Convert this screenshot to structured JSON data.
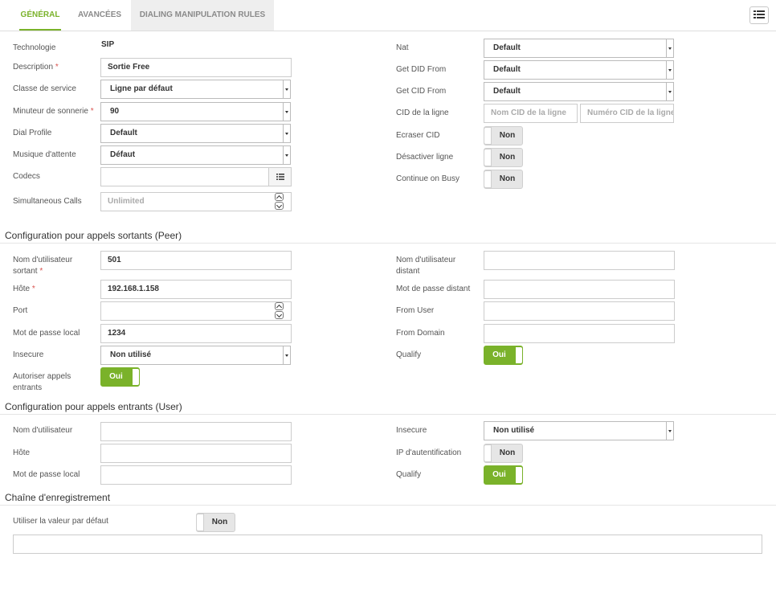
{
  "tabs": [
    {
      "label": "GÉNÉRAL",
      "active": true
    },
    {
      "label": "AVANCÉES",
      "active": false
    },
    {
      "label": "DIALING MANIPULATION RULES",
      "active": false
    }
  ],
  "toolbar": {
    "list_icon": "list-icon"
  },
  "general": {
    "technology": {
      "label": "Technologie",
      "value": "SIP"
    },
    "description": {
      "label": "Description",
      "value": "Sortie Free"
    },
    "service_class": {
      "label": "Classe de service",
      "value": "Ligne par défaut"
    },
    "ring_timer": {
      "label": "Minuteur de sonnerie",
      "value": "90"
    },
    "dial_profile": {
      "label": "Dial Profile",
      "value": "Default"
    },
    "music_on_hold": {
      "label": "Musique d'attente",
      "value": "Défaut"
    },
    "codecs": {
      "label": "Codecs",
      "value": ""
    },
    "simultaneous_calls": {
      "label": "Simultaneous Calls",
      "placeholder": "Unlimited"
    },
    "nat": {
      "label": "Nat",
      "value": "Default"
    },
    "get_did_from": {
      "label": "Get DID From",
      "value": "Default"
    },
    "get_cid_from": {
      "label": "Get CID From",
      "value": "Default"
    },
    "line_cid": {
      "label": "CID de la ligne",
      "name_placeholder": "Nom CID de la ligne",
      "number_placeholder": "Numéro CID de la ligne"
    },
    "overwrite_cid": {
      "label": "Ecraser CID",
      "state": "Non"
    },
    "disable_line": {
      "label": "Désactiver ligne",
      "state": "Non"
    },
    "continue_on_busy": {
      "label": "Continue on Busy",
      "state": "Non"
    }
  },
  "peer": {
    "title": "Configuration pour appels sortants (Peer)",
    "username_line1": "Nom d'utilisateur",
    "username_line2": "sortant",
    "username_value": "501",
    "host": {
      "label": "Hôte",
      "value": "192.168.1.158"
    },
    "port": {
      "label": "Port",
      "value": ""
    },
    "local_password": {
      "label": "Mot de passe local",
      "value": "1234"
    },
    "insecure": {
      "label": "Insecure",
      "value": "Non utilisé"
    },
    "allow_incoming_line1": "Autoriser appels",
    "allow_incoming_line2": "entrants",
    "allow_incoming_state": "Oui",
    "remote_username_line1": "Nom d'utilisateur",
    "remote_username_line2": "distant",
    "remote_username_value": "",
    "remote_password": {
      "label": "Mot de passe distant",
      "value": ""
    },
    "from_user": {
      "label": "From User",
      "value": ""
    },
    "from_domain": {
      "label": "From Domain",
      "value": ""
    },
    "qualify": {
      "label": "Qualify",
      "state": "Oui"
    }
  },
  "user": {
    "title": "Configuration pour appels entrants (User)",
    "username": {
      "label": "Nom d'utilisateur",
      "value": ""
    },
    "host": {
      "label": "Hôte",
      "value": ""
    },
    "local_password": {
      "label": "Mot de passe local",
      "value": ""
    },
    "insecure": {
      "label": "Insecure",
      "value": "Non utilisé"
    },
    "ip_auth": {
      "label": "IP d'autentification",
      "state": "Non"
    },
    "qualify": {
      "label": "Qualify",
      "state": "Oui"
    }
  },
  "registration": {
    "title": "Chaîne d'enregistrement",
    "use_default": {
      "label": "Utiliser la valeur par défaut",
      "state": "Non"
    },
    "value": ""
  },
  "colors": {
    "accent": "#7ab22a",
    "required": "#d9534f",
    "border": "#cccccc"
  },
  "required_mark": "*"
}
